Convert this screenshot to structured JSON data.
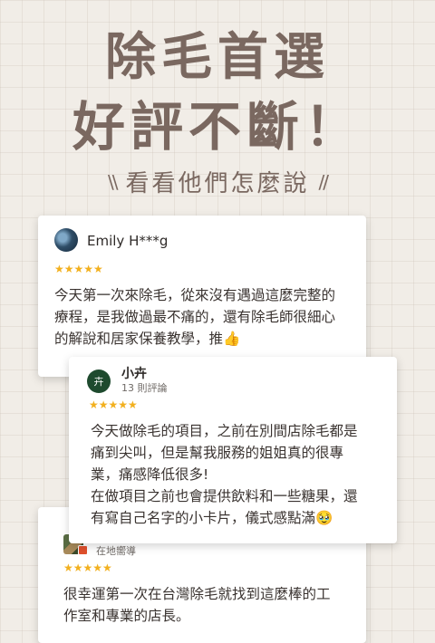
{
  "headline": {
    "line1": "除毛首選",
    "line2": "好評不斷！"
  },
  "subtitle": {
    "left_deco": "\\\\",
    "text": "看看他們怎麼說",
    "right_deco": "//"
  },
  "reviews": [
    {
      "name": "Emily H***g",
      "meta": "",
      "stars": "★★★★★",
      "text": "今天第一次來除毛，從來沒有遇過這麼完整的\n療程，是我做過最不痛的，還有除毛師很細心\n的解說和居家保養教學，推👍",
      "avatar": "photo"
    },
    {
      "name": "小卉",
      "meta": "13 則評論",
      "stars": "★★★★★",
      "text": "今天做除毛的項目，之前在別間店除毛都是\n痛到尖叫，但是幫我服務的姐姐真的很專\n業，痛感降低很多!\n在做項目之前也會提供飲料和一些糖果，還\n有寫自己名字的小卡片，儀式感點滿🥹",
      "avatar_letter": "卉"
    },
    {
      "name": "",
      "meta": "在地嚮導",
      "stars": "★★★★★",
      "text": "很幸運第一次在台灣除毛就找到這麼棒的工\n作室和專業的店長。",
      "avatar": "photo"
    }
  ],
  "colors": {
    "background": "#f1ede7",
    "headline": "#7a6860",
    "star": "#f2b01e",
    "card": "#ffffff"
  }
}
